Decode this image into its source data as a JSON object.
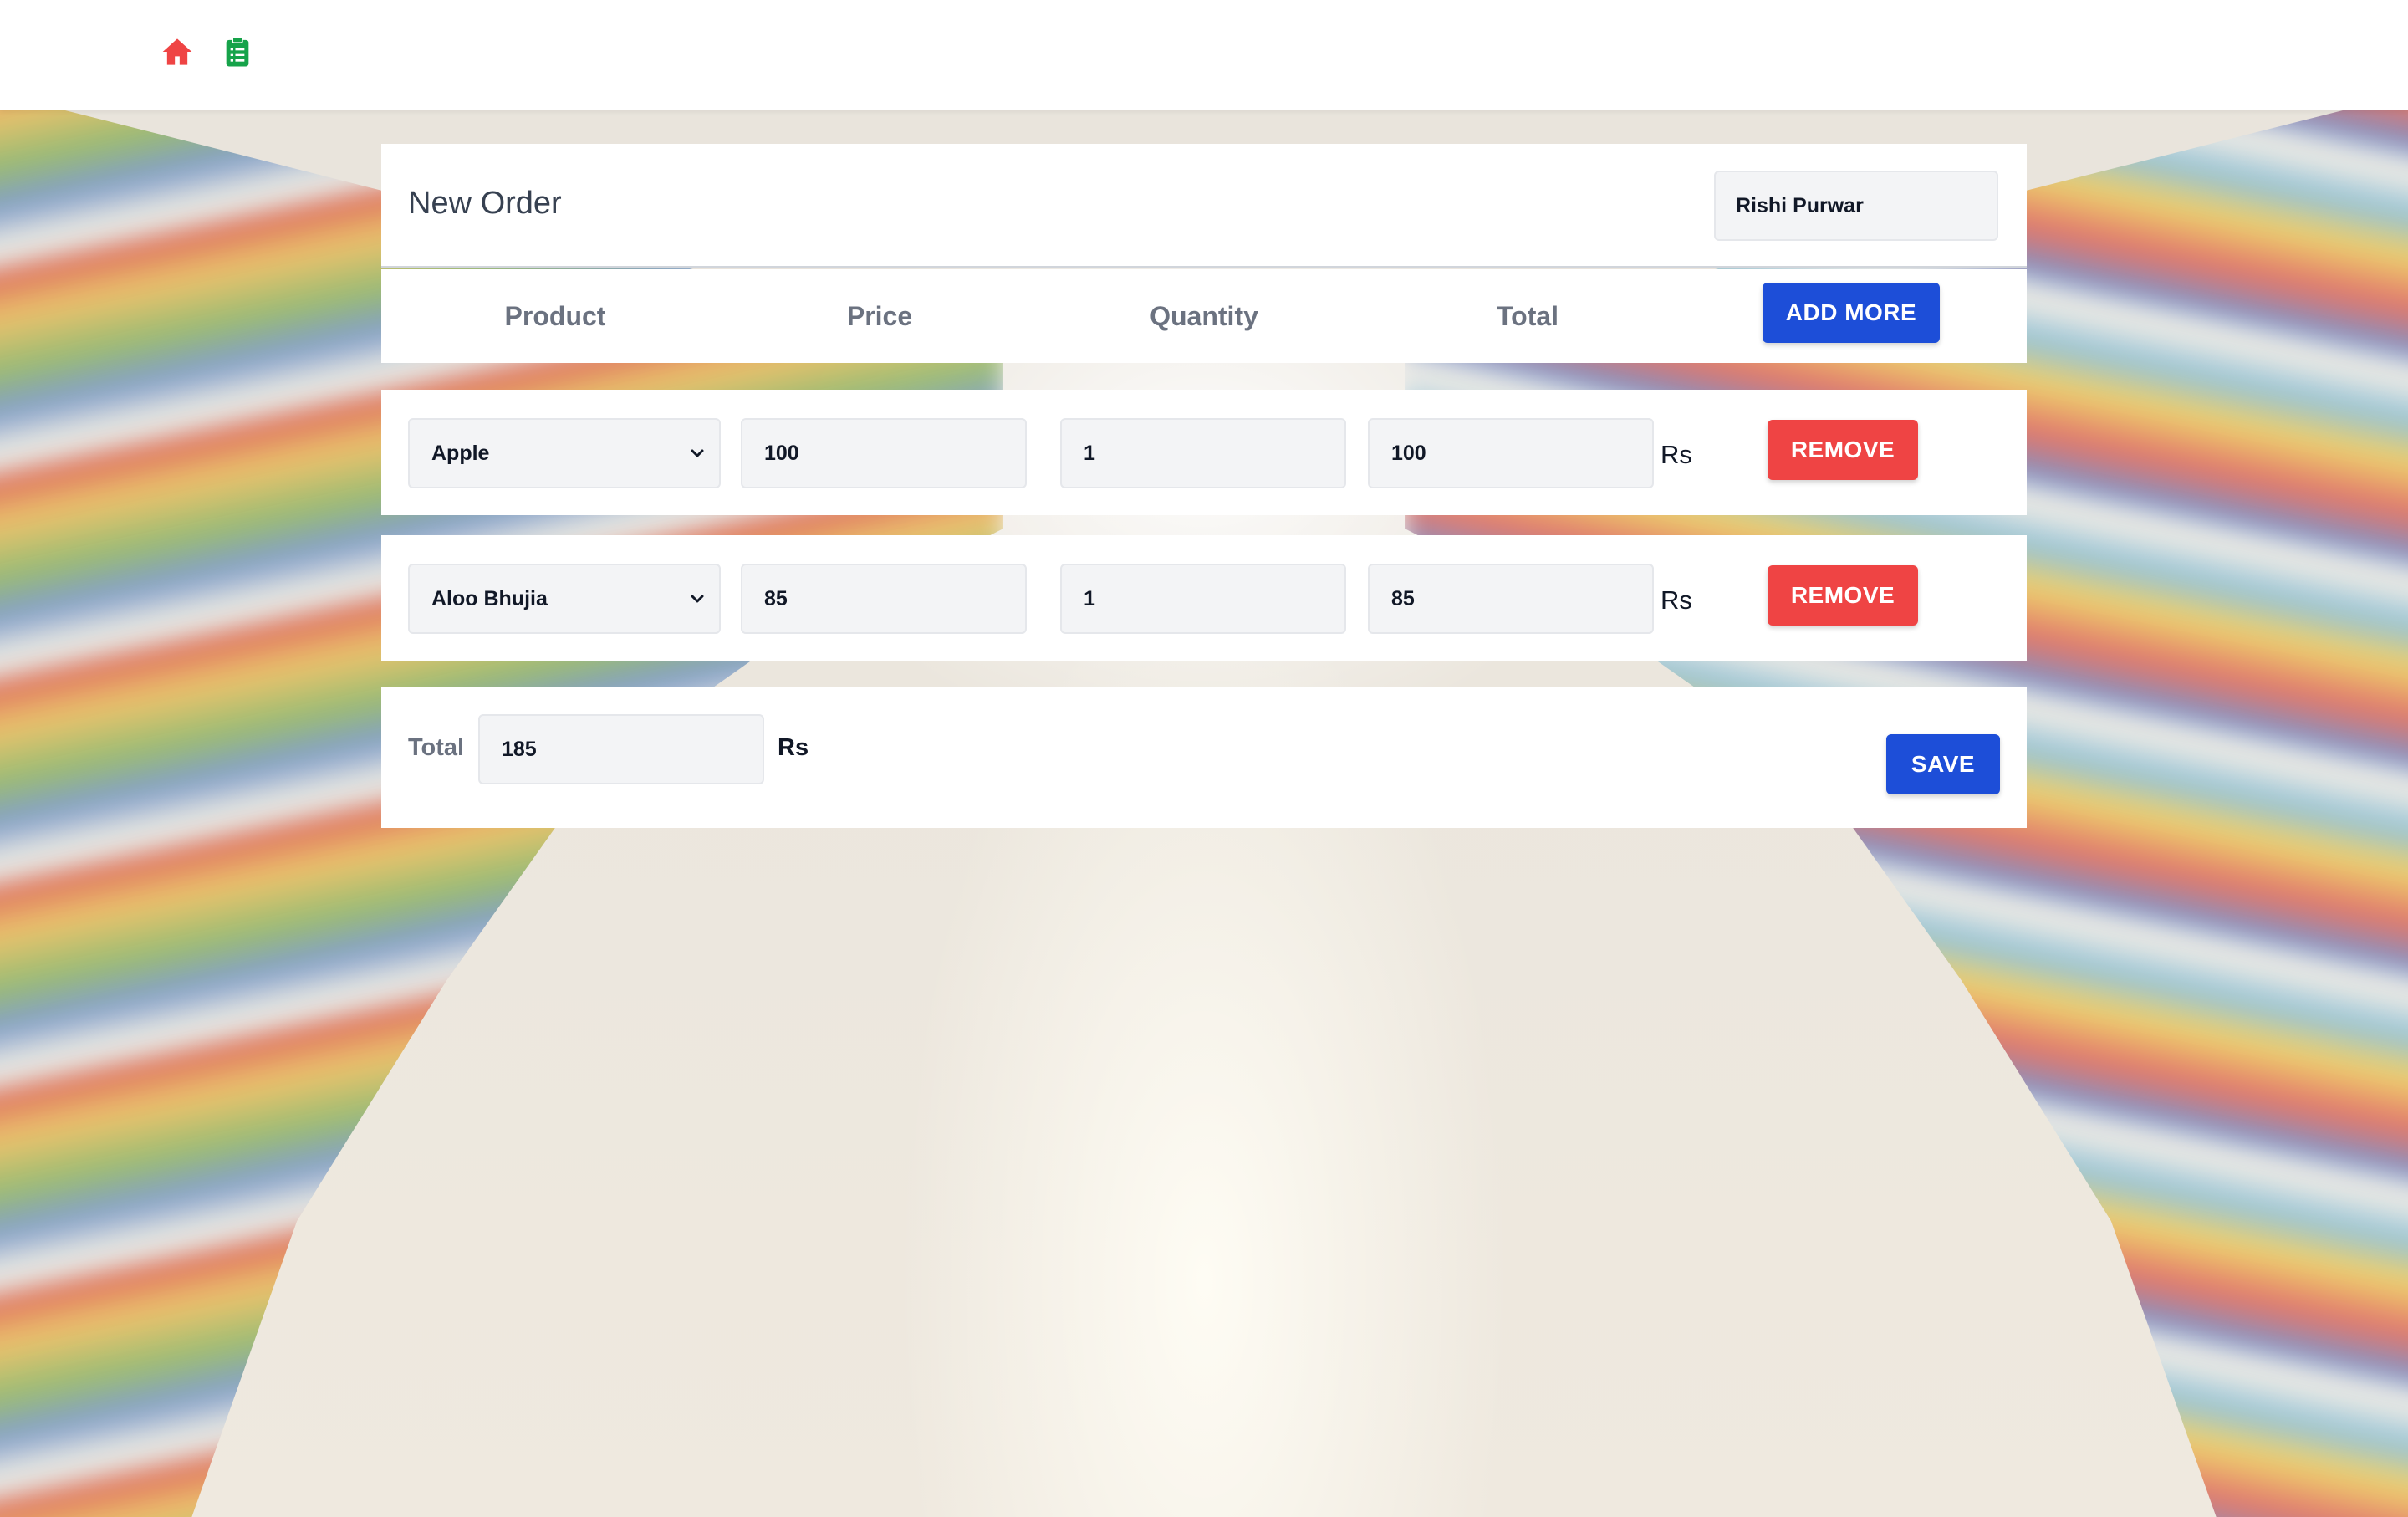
{
  "nav": {
    "home_icon": "home-icon",
    "orders_icon": "clipboard-list-icon",
    "colors": {
      "home": "#ef4444",
      "orders": "#16a34a"
    }
  },
  "order": {
    "title": "New Order",
    "customer_name": "Rishi Purwar"
  },
  "columns": {
    "product": "Product",
    "price": "Price",
    "quantity": "Quantity",
    "total": "Total",
    "add_more_label": "ADD MORE"
  },
  "items": [
    {
      "product": "Apple",
      "price": "100",
      "quantity": "1",
      "total": "100",
      "currency": "Rs",
      "remove_label": "REMOVE"
    },
    {
      "product": "Aloo Bhujia",
      "price": "85",
      "quantity": "1",
      "total": "85",
      "currency": "Rs",
      "remove_label": "REMOVE"
    }
  ],
  "summary": {
    "total_label": "Total",
    "total_value": "185",
    "currency": "Rs",
    "save_label": "SAVE"
  },
  "colors": {
    "primary": "#1d4ed8",
    "danger": "#ef4444",
    "input_bg": "#f3f4f6",
    "muted_text": "#6b7280"
  }
}
